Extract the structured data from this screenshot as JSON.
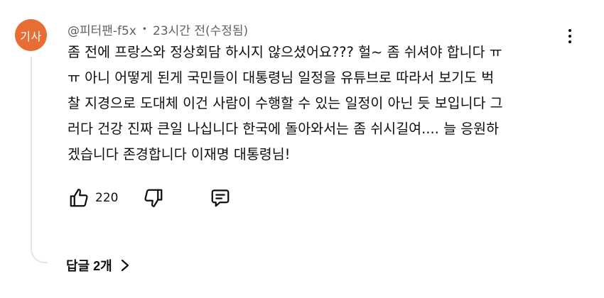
{
  "comment": {
    "avatar_text": "기사",
    "avatar_color": "#e86d35",
    "author": "@피터팬-f5x",
    "separator": "•",
    "timestamp": "23시간 전(수정됨)",
    "more_icon": "more-vertical-icon",
    "text_lines": [
      "좀 전에 프랑스와 정상회담 하시지 않으셨어요??? 헐~ 좀 쉬셔야 합니다 ㅠ",
      "ㅠ 아니 어떻게 된게 국민들이 대통령님 일정을 유튜브로 따라서 보기도 벅",
      "찰 지경으로 도대체 이건 사람이 수행할 수 있는 일정이 아닌 듯 보입니다 그",
      "러다 건강 진짜 큰일 나십니다 한국에 돌아와서는 좀 쉬시길여.... 늘 응원하",
      "겠습니다 존경합니다 이재명 대통령님!"
    ],
    "actions": {
      "like_icon": "thumbs-up-icon",
      "like_count": "220",
      "dislike_icon": "thumbs-down-icon",
      "reply_icon": "comment-icon"
    },
    "replies": {
      "label": "답글 2개",
      "icon": "chevron-right-icon"
    }
  }
}
